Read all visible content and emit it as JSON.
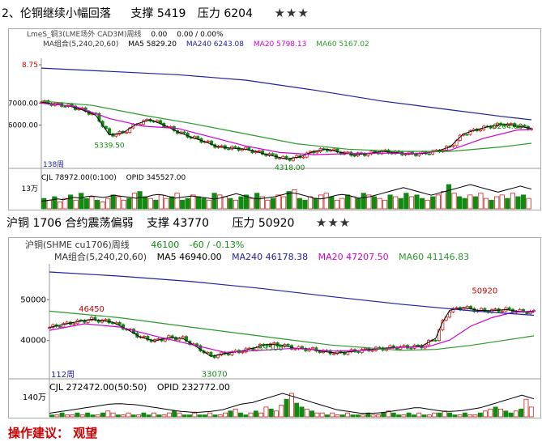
{
  "header1": {
    "title": "2、伦铜继续小幅回落",
    "support": "支撑 5419",
    "resistance": "压力 6204",
    "stars": "★★★"
  },
  "header2": {
    "title": "沪铜 1706 合约震荡偏弱",
    "support": "支撑 43770",
    "resistance": "压力 50920",
    "stars": "★★★"
  },
  "advice": "操作建议：  观望",
  "colors": {
    "ma5": "#000000",
    "ma20": "#d000d0",
    "ma60": "#2a9a2a",
    "ma240": "#2020a0",
    "up": "#d02020",
    "down": "#108a10"
  },
  "chart_data": [
    {
      "type": "line",
      "title": "LmeS_铜3(LME场外 CAD3M)周线",
      "quote": [
        "0.00",
        "0.00 / 0.00%"
      ],
      "ma_line": [
        "MA组合(5,240,20,60)",
        "MA5 5829.20",
        "MA240 6243.08",
        "MA20 5798.13",
        "MA60 5167.02"
      ],
      "y_ticks": [
        "8.75",
        "7000.00",
        "6000.00"
      ],
      "ylim": [
        4100,
        8900
      ],
      "period_label": "138周",
      "annotations": [
        {
          "text": "5339.50",
          "x": 20,
          "y": 5339.5
        },
        {
          "text": "4318.00",
          "x": 73,
          "y": 4318
        },
        {
          "text": "6204.00",
          "x": 137,
          "y": 6204
        }
      ],
      "series": [
        {
          "name": "MA5",
          "values": [
            [
              0,
              7050
            ],
            [
              4,
              6950
            ],
            [
              8,
              6880
            ],
            [
              12,
              6700
            ],
            [
              16,
              6450
            ],
            [
              20,
              5550
            ],
            [
              24,
              5650
            ],
            [
              28,
              6050
            ],
            [
              32,
              6250
            ],
            [
              36,
              6000
            ],
            [
              40,
              5700
            ],
            [
              44,
              5450
            ],
            [
              48,
              5250
            ],
            [
              52,
              5000
            ],
            [
              56,
              4950
            ],
            [
              60,
              4900
            ],
            [
              64,
              4750
            ],
            [
              68,
              4600
            ],
            [
              72,
              4450
            ],
            [
              76,
              4550
            ],
            [
              80,
              4800
            ],
            [
              84,
              4900
            ],
            [
              88,
              4750
            ],
            [
              92,
              4650
            ],
            [
              96,
              4700
            ],
            [
              100,
              4800
            ],
            [
              104,
              4750
            ],
            [
              108,
              4680
            ],
            [
              112,
              4700
            ],
            [
              116,
              4800
            ],
            [
              120,
              5000
            ],
            [
              124,
              5600
            ],
            [
              128,
              5800
            ],
            [
              132,
              5950
            ],
            [
              136,
              6050
            ],
            [
              140,
              5950
            ],
            [
              144,
              5850
            ]
          ]
        },
        {
          "name": "MA20",
          "values": [
            [
              0,
              7000
            ],
            [
              10,
              6850
            ],
            [
              20,
              6300
            ],
            [
              30,
              5950
            ],
            [
              40,
              5850
            ],
            [
              50,
              5450
            ],
            [
              60,
              5050
            ],
            [
              70,
              4750
            ],
            [
              80,
              4650
            ],
            [
              90,
              4700
            ],
            [
              100,
              4720
            ],
            [
              110,
              4700
            ],
            [
              120,
              4850
            ],
            [
              130,
              5400
            ],
            [
              140,
              5780
            ],
            [
              144,
              5800
            ]
          ]
        },
        {
          "name": "MA60",
          "values": [
            [
              0,
              7100
            ],
            [
              15,
              6900
            ],
            [
              30,
              6450
            ],
            [
              45,
              6050
            ],
            [
              60,
              5600
            ],
            [
              75,
              5150
            ],
            [
              90,
              4900
            ],
            [
              105,
              4800
            ],
            [
              120,
              4800
            ],
            [
              135,
              5000
            ],
            [
              144,
              5170
            ]
          ]
        },
        {
          "name": "MA240",
          "values": [
            [
              0,
              8600
            ],
            [
              20,
              8450
            ],
            [
              40,
              8300
            ],
            [
              60,
              8050
            ],
            [
              80,
              7600
            ],
            [
              100,
              7100
            ],
            [
              120,
              6700
            ],
            [
              135,
              6400
            ],
            [
              144,
              6240
            ]
          ]
        }
      ],
      "volume": {
        "label": "CJL  78972.00(0:100)",
        "opid": "OPID  345527.00",
        "axis": "13万",
        "bars": [
          6,
          5,
          7,
          4,
          6,
          8,
          5,
          9,
          6,
          7,
          5,
          4,
          6,
          8,
          7,
          5,
          6,
          9,
          10,
          7,
          6,
          5,
          8,
          6,
          7,
          9,
          5,
          6,
          8,
          7,
          6,
          5,
          9,
          8,
          7,
          6,
          5,
          7,
          8,
          6,
          9,
          7,
          5,
          6,
          8,
          7,
          10,
          11,
          6,
          5,
          7,
          6,
          8,
          9,
          7,
          5,
          6,
          8,
          7,
          6,
          9,
          8,
          7,
          6,
          5,
          8,
          7,
          6,
          9,
          7,
          8,
          6,
          5,
          7,
          8,
          10,
          14,
          9,
          7,
          6,
          8,
          7,
          9,
          6,
          5,
          7,
          8,
          6,
          9,
          7,
          8,
          6
        ],
        "oi": [
          5,
          5.5,
          6,
          6.5,
          6,
          7,
          7.5,
          7,
          8,
          8.5,
          8,
          7.5,
          8,
          9,
          8.5,
          8,
          7.5,
          7,
          7.5,
          8,
          9,
          9.5,
          9,
          8,
          7,
          7.5,
          8,
          8.5,
          8,
          7.5,
          7,
          6.5,
          7,
          8,
          9,
          10,
          9,
          8,
          7,
          6.5,
          7,
          7.5,
          8,
          9,
          10,
          10.5,
          10,
          9,
          8,
          7,
          6.5,
          7,
          8,
          9,
          9.5,
          9,
          8,
          7,
          7.5,
          8,
          9,
          10,
          11,
          12,
          13,
          14,
          13,
          12,
          11,
          10,
          9,
          10,
          11,
          12,
          13,
          14,
          15,
          16,
          15,
          14,
          13,
          12,
          11,
          12,
          13,
          14,
          15,
          14,
          13
        ]
      }
    },
    {
      "type": "line",
      "title": "沪铜(SHME  cu1706)周线",
      "quote": [
        "46100",
        "-60 / -0.13%"
      ],
      "ma_line": [
        "MA组合(5,240,20,60)",
        "MA5 46940.00",
        "MA240 46178.38",
        "MA20 47207.50",
        "MA60 41146.83"
      ],
      "y_ticks": [
        "50000",
        "40000"
      ],
      "ylim": [
        31000,
        58000
      ],
      "period_label": "112周",
      "annotations": [
        {
          "text": "46450",
          "x": 12,
          "y": 46450
        },
        {
          "text": "39500",
          "x": 63,
          "y": 39500
        },
        {
          "text": "33070",
          "x": 47,
          "y": 33070
        },
        {
          "text": "50920",
          "x": 124,
          "y": 50920
        }
      ],
      "series": [
        {
          "name": "MA5",
          "values": [
            [
              0,
              43200
            ],
            [
              6,
              44300
            ],
            [
              12,
              45200
            ],
            [
              18,
              44500
            ],
            [
              22,
              42800
            ],
            [
              26,
              40800
            ],
            [
              30,
              39900
            ],
            [
              34,
              40700
            ],
            [
              38,
              40500
            ],
            [
              42,
              38400
            ],
            [
              46,
              36100
            ],
            [
              50,
              36800
            ],
            [
              54,
              37300
            ],
            [
              58,
              38100
            ],
            [
              62,
              39100
            ],
            [
              66,
              38900
            ],
            [
              70,
              38100
            ],
            [
              74,
              37900
            ],
            [
              78,
              37300
            ],
            [
              82,
              36900
            ],
            [
              86,
              37300
            ],
            [
              90,
              37700
            ],
            [
              94,
              38000
            ],
            [
              98,
              38300
            ],
            [
              102,
              38400
            ],
            [
              106,
              38600
            ],
            [
              110,
              40500
            ],
            [
              112,
              44500
            ],
            [
              114,
              47400
            ],
            [
              118,
              48100
            ],
            [
              122,
              47400
            ],
            [
              126,
              47300
            ],
            [
              130,
              47600
            ],
            [
              134,
              47100
            ],
            [
              138,
              46950
            ]
          ]
        },
        {
          "name": "MA20",
          "values": [
            [
              0,
              42500
            ],
            [
              10,
              44100
            ],
            [
              20,
              43300
            ],
            [
              30,
              41100
            ],
            [
              40,
              39100
            ],
            [
              50,
              37100
            ],
            [
              60,
              37600
            ],
            [
              70,
              38100
            ],
            [
              80,
              37400
            ],
            [
              90,
              37600
            ],
            [
              100,
              38300
            ],
            [
              108,
              38500
            ],
            [
              114,
              40100
            ],
            [
              120,
              43500
            ],
            [
              126,
              45600
            ],
            [
              132,
              46900
            ],
            [
              138,
              47200
            ]
          ]
        },
        {
          "name": "MA60",
          "values": [
            [
              0,
              47200
            ],
            [
              20,
              45600
            ],
            [
              40,
              43300
            ],
            [
              60,
              41100
            ],
            [
              80,
              38900
            ],
            [
              100,
              37600
            ],
            [
              110,
              37800
            ],
            [
              120,
              38800
            ],
            [
              130,
              40100
            ],
            [
              138,
              41150
            ]
          ]
        },
        {
          "name": "MA240",
          "values": [
            [
              0,
              56800
            ],
            [
              20,
              55800
            ],
            [
              40,
              54500
            ],
            [
              60,
              52800
            ],
            [
              80,
              50800
            ],
            [
              100,
              48900
            ],
            [
              120,
              47300
            ],
            [
              138,
              46180
            ]
          ]
        }
      ],
      "volume": {
        "label": "CJL  272472.00(50:50)",
        "opid": "OPID  232772.00",
        "axis": "140万",
        "bars": [
          1,
          1,
          2,
          1,
          1,
          2,
          1,
          2,
          1,
          1,
          2,
          3,
          2,
          1,
          1,
          2,
          1,
          1,
          2,
          1,
          2,
          1,
          1,
          2,
          3,
          2,
          1,
          1,
          2,
          1,
          1,
          2,
          1,
          1,
          2,
          3,
          4,
          2,
          1,
          2,
          3,
          2,
          5,
          4,
          3,
          6,
          9,
          12,
          7,
          5,
          4,
          3,
          2,
          2,
          1,
          2,
          1,
          1,
          2,
          1,
          1,
          1,
          2,
          1,
          1,
          2,
          3,
          2,
          1,
          1,
          2,
          1,
          2,
          1,
          1,
          2,
          2,
          3,
          2,
          1,
          1,
          2,
          1,
          1,
          2,
          3,
          4,
          5,
          4,
          3,
          2,
          3,
          4,
          9,
          5
        ],
        "oi": [
          2,
          2.5,
          3,
          3.5,
          4,
          4.5,
          5,
          5.5,
          6,
          6.5,
          7,
          7.2,
          7.3,
          7,
          6.8,
          6.5,
          6,
          5.5,
          5,
          4.5,
          4,
          3.5,
          3,
          2.8,
          2.5,
          2.5,
          2.8,
          3,
          3.5,
          4,
          5,
          6,
          7,
          7.5,
          8,
          9,
          10,
          11,
          12,
          13,
          12,
          11,
          10,
          9,
          8,
          7,
          6,
          5,
          4,
          3.5,
          3,
          2.5,
          2,
          2,
          2,
          2.2,
          2.5,
          3,
          3.5,
          4,
          4.5,
          5,
          5,
          4.5,
          4,
          3.5,
          3,
          3,
          3.2,
          3.5,
          4,
          4.5,
          5,
          6,
          7,
          8,
          9,
          10,
          11,
          12,
          11,
          10
        ]
      }
    }
  ]
}
